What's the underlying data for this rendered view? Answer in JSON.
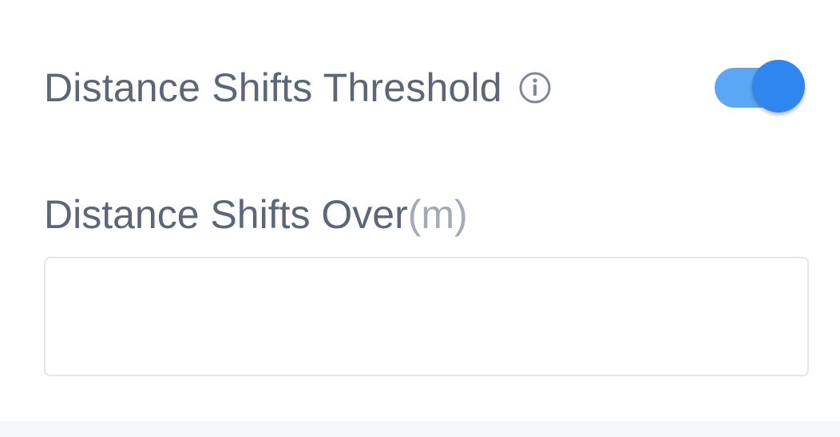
{
  "threshold": {
    "label": "Distance Shifts Threshold",
    "info_icon": "info-circle-icon",
    "enabled": true
  },
  "distance_over": {
    "label": "Distance Shifts Over",
    "unit": "(m)",
    "value": "",
    "placeholder": ""
  },
  "colors": {
    "label_text": "#5b6676",
    "unit_text": "#a3abb6",
    "toggle_track": "#5aa7f5",
    "toggle_thumb": "#2e86ee",
    "input_border": "#e3e6ea",
    "footer_band": "#f6f7f9"
  }
}
